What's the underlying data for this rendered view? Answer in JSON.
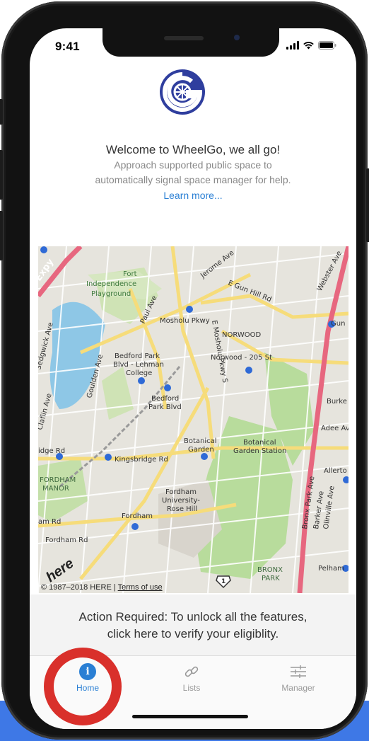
{
  "status": {
    "time": "9:41"
  },
  "header": {
    "welcome_title": "Welcome to WheelGo, we all go!",
    "description_line1": "Approach supported public space to",
    "description_line2": "automatically signal space manager for help.",
    "learn_more": "Learn more..."
  },
  "map": {
    "labels": {
      "expy": "Expy",
      "fort": "Fort",
      "independence": "Independence",
      "playground": "Playground",
      "jerome": "Jerome Ave",
      "gun_hill": "E Gun Hill Rd",
      "webster": "Webster Ave",
      "mosholu": "Mosholu Pkwy",
      "norwood": "NORWOOD",
      "norwood_205": "Norwood - 205 St",
      "bedford_lehman_1": "Bedford Park",
      "bedford_lehman_2": "Blvd - Lehman",
      "bedford_lehman_3": "College",
      "bedford_park_1": "Bedford",
      "bedford_park_2": "Park Blvd",
      "goulden": "Goulden Ave",
      "sedgwick": "Sedgwick Ave",
      "claflin": "Claflin Ave",
      "paul": "Paul Ave",
      "mosholu_pkwy_s": "E Mosholu Pkwy S",
      "kingsbridge": "Kingsbridge Rd",
      "ridge_rd": "idge Rd",
      "botanical_garden_1": "Botanical",
      "botanical_garden_2": "Garden",
      "botanical_station_1": "Botanical",
      "botanical_station_2": "Garden Station",
      "fordham_manor_1": "FORDHAM",
      "fordham_manor_2": "MANOR",
      "fordham_univ_1": "Fordham",
      "fordham_univ_2": "University-",
      "fordham_univ_3": "Rose Hill",
      "fordham": "Fordham",
      "fordham_rd": "Fordham Rd",
      "am_rd": "am Rd",
      "bronx_park_1": "BRONX",
      "bronx_park_2": "PARK",
      "pelham": "Pelham",
      "burke": "Burke",
      "adee": "Adee Av",
      "allerton": "Allerto",
      "gun": "Gun",
      "bronx_park_ave": "Bronx Park Ave",
      "barker": "Barker Ave",
      "olinville": "Olinville Ave",
      "route_1": "1"
    },
    "copyright_prefix": "© 1987–2018 HERE | ",
    "terms_link": "Terms of use",
    "here_logo": "here"
  },
  "action": {
    "line1": "Action Required: To unlock all the features,",
    "line2": "click here to verify your eligiblity."
  },
  "tabs": [
    {
      "label": "Home",
      "icon": "info-icon",
      "active": true,
      "color": "#2a7fd4"
    },
    {
      "label": "Lists",
      "icon": "link-icon",
      "active": false,
      "color": "#9a9a9a"
    },
    {
      "label": "Manager",
      "icon": "sliders-icon",
      "active": false,
      "color": "#9a9a9a"
    }
  ],
  "colors": {
    "accent": "#2a7fd4",
    "highlight_ring": "#d9302b",
    "logo": "#2f3e9e"
  }
}
